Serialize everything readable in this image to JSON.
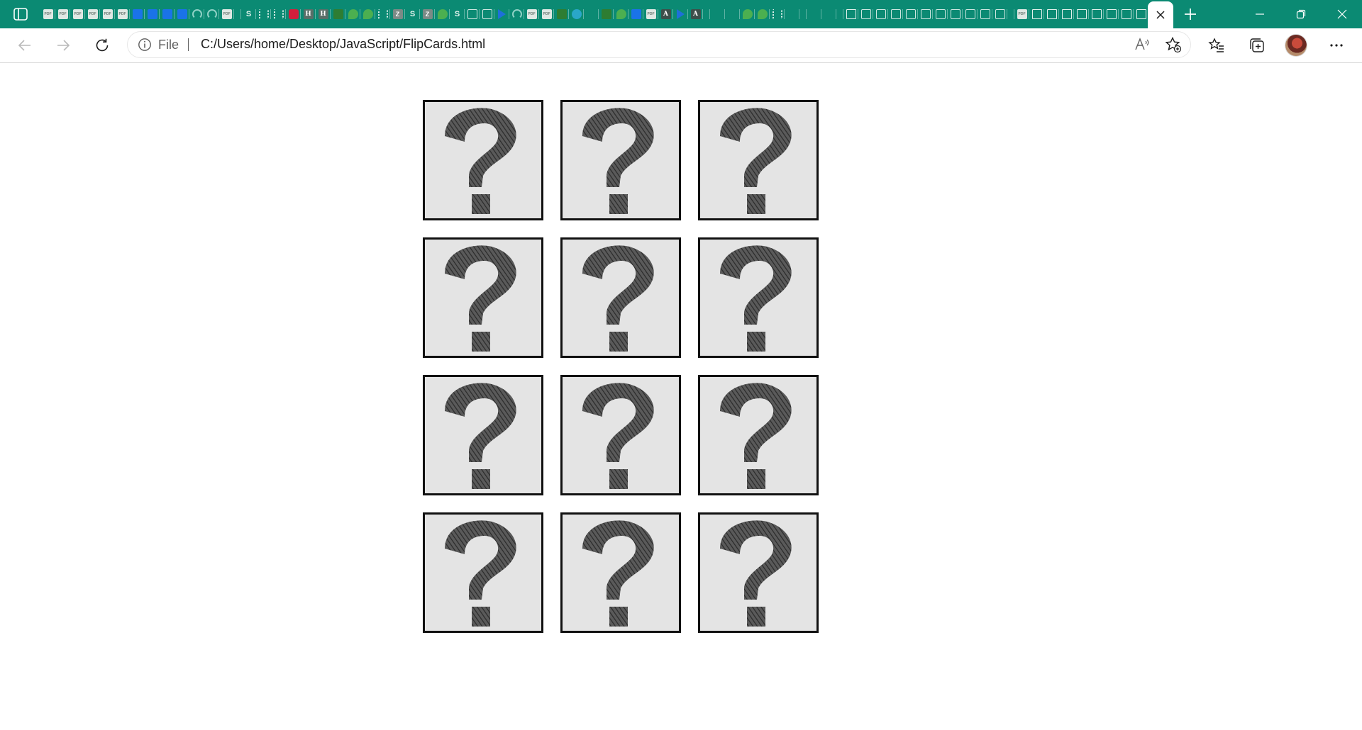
{
  "browser": {
    "active_tab": {
      "close_icon": "close-icon"
    },
    "new_tab_icon": "plus-icon",
    "window_controls": [
      "minimize-icon",
      "restore-icon",
      "close-icon"
    ],
    "colors": {
      "tabstrip": "#0b8a73",
      "toolbar": "#ffffff"
    },
    "tab_favicons": [
      "pdf",
      "pdf",
      "pdf",
      "pdf",
      "pdf",
      "pdf",
      "blue",
      "blue",
      "blue",
      "blue",
      "arc",
      "arc",
      "pdf",
      "gap",
      "s",
      "list",
      "list",
      "red",
      "h",
      "h",
      "green",
      "leaf",
      "leaf",
      "list",
      "z",
      "s",
      "z",
      "leaf",
      "s",
      "doc",
      "doc",
      "tri",
      "arc",
      "pdf",
      "pdf",
      "green",
      "check",
      "dim",
      "green",
      "leaf",
      "blue",
      "pdf",
      "a",
      "tri",
      "a",
      "gap",
      "dim",
      "dim",
      "leaf",
      "leaf",
      "list",
      "dim",
      "gap",
      "dim",
      "dim",
      "gap",
      "page",
      "doc",
      "doc",
      "doc",
      "doc",
      "doc",
      "doc",
      "doc",
      "doc",
      "doc",
      "doc",
      "gap",
      "pdf",
      "page",
      "page",
      "page",
      "page",
      "page",
      "page",
      "page",
      "page"
    ]
  },
  "toolbar": {
    "site_label": "File",
    "url": "C:/Users/home/Desktop/JavaScript/FlipCards.html",
    "icons": [
      "back-icon",
      "forward-icon",
      "refresh-icon",
      "info-icon",
      "read-aloud-icon",
      "add-favorite-icon",
      "favorites-icon",
      "collections-icon",
      "more-icon"
    ]
  },
  "page": {
    "cards": [
      {
        "face": "question-mark",
        "state": "face-down"
      },
      {
        "face": "question-mark",
        "state": "face-down"
      },
      {
        "face": "question-mark",
        "state": "face-down"
      },
      {
        "face": "question-mark",
        "state": "face-down"
      },
      {
        "face": "question-mark",
        "state": "face-down"
      },
      {
        "face": "question-mark",
        "state": "face-down"
      },
      {
        "face": "question-mark",
        "state": "face-down"
      },
      {
        "face": "question-mark",
        "state": "face-down"
      },
      {
        "face": "question-mark",
        "state": "face-down"
      },
      {
        "face": "question-mark",
        "state": "face-down"
      },
      {
        "face": "question-mark",
        "state": "face-down"
      },
      {
        "face": "question-mark",
        "state": "face-down"
      }
    ],
    "colors": {
      "card_background": "#e4e4e4",
      "card_border": "#111111"
    }
  }
}
